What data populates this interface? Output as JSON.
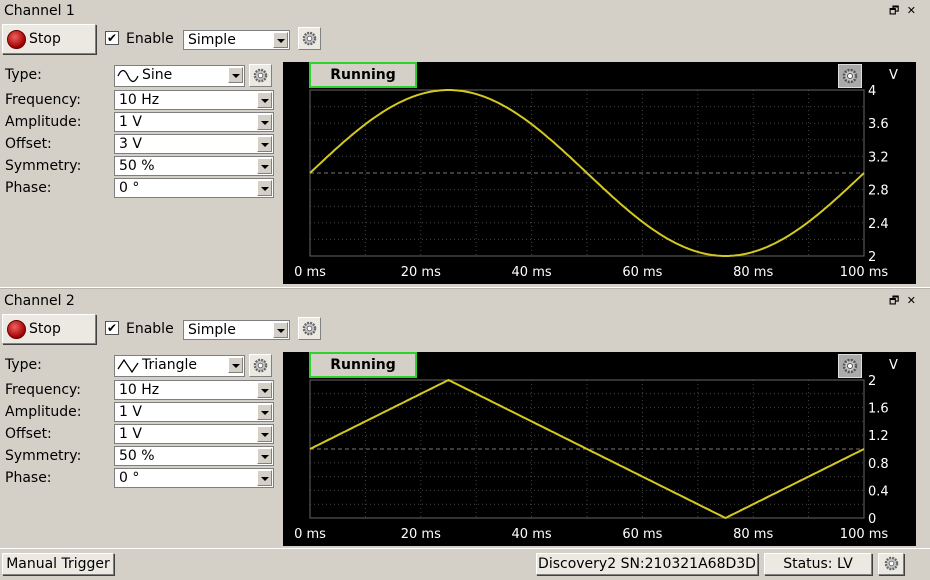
{
  "channels": [
    {
      "title": "Channel 1",
      "stop_label": "Stop",
      "enable_label": "Enable",
      "enabled": true,
      "mode": "Simple",
      "fields": [
        {
          "label": "Type:",
          "value": "Sine"
        },
        {
          "label": "Frequency:",
          "value": "10 Hz"
        },
        {
          "label": "Amplitude:",
          "value": "1 V"
        },
        {
          "label": "Offset:",
          "value": "3 V"
        },
        {
          "label": "Symmetry:",
          "value": "50 %"
        },
        {
          "label": "Phase:",
          "value": "0 °"
        }
      ],
      "plot": {
        "status": "Running",
        "unit": "V",
        "y_ticks": [
          "4",
          "3.6",
          "3.2",
          "2.8",
          "2.4",
          "2"
        ],
        "x_ticks": [
          "0 ms",
          "20 ms",
          "40 ms",
          "60 ms",
          "80 ms",
          "100 ms"
        ]
      }
    },
    {
      "title": "Channel 2",
      "stop_label": "Stop",
      "enable_label": "Enable",
      "enabled": true,
      "mode": "Simple",
      "fields": [
        {
          "label": "Type:",
          "value": "Triangle"
        },
        {
          "label": "Frequency:",
          "value": "10 Hz"
        },
        {
          "label": "Amplitude:",
          "value": "1 V"
        },
        {
          "label": "Offset:",
          "value": "1 V"
        },
        {
          "label": "Symmetry:",
          "value": "50 %"
        },
        {
          "label": "Phase:",
          "value": "0 °"
        }
      ],
      "plot": {
        "status": "Running",
        "unit": "V",
        "y_ticks": [
          "2",
          "1.6",
          "1.2",
          "0.8",
          "0.4",
          "0"
        ],
        "x_ticks": [
          "0 ms",
          "20 ms",
          "40 ms",
          "60 ms",
          "80 ms",
          "100 ms"
        ]
      }
    }
  ],
  "statusbar": {
    "trigger_label": "Manual Trigger",
    "device_label": "Discovery2 SN:210321A68D3D",
    "status_label": "Status: LV"
  },
  "colors": {
    "trace": "#d4c820",
    "running_border": "#2ed22e",
    "plot_bg": "#000000"
  }
}
